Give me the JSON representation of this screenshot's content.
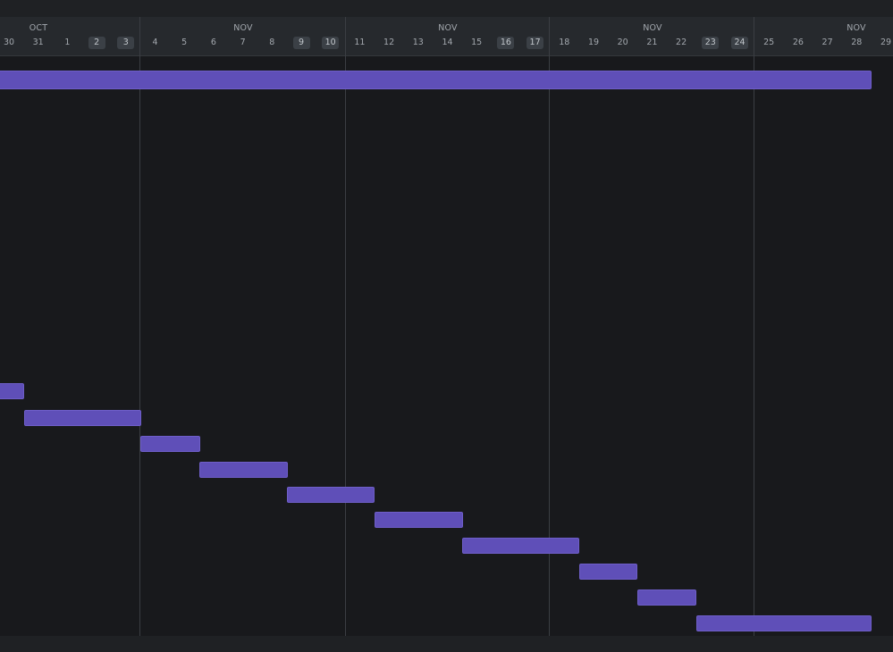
{
  "timeline": {
    "months": [
      "OCT",
      "NOV",
      "NOV",
      "NOV",
      "NOV"
    ],
    "days": [
      {
        "label": "30",
        "weekend": false
      },
      {
        "label": "31",
        "weekend": false
      },
      {
        "label": "1",
        "weekend": false
      },
      {
        "label": "2",
        "weekend": true
      },
      {
        "label": "3",
        "weekend": true
      },
      {
        "label": "4",
        "weekend": false
      },
      {
        "label": "5",
        "weekend": false
      },
      {
        "label": "6",
        "weekend": false
      },
      {
        "label": "7",
        "weekend": false
      },
      {
        "label": "8",
        "weekend": false
      },
      {
        "label": "9",
        "weekend": true
      },
      {
        "label": "10",
        "weekend": true
      },
      {
        "label": "11",
        "weekend": false
      },
      {
        "label": "12",
        "weekend": false
      },
      {
        "label": "13",
        "weekend": false
      },
      {
        "label": "14",
        "weekend": false
      },
      {
        "label": "15",
        "weekend": false
      },
      {
        "label": "16",
        "weekend": true
      },
      {
        "label": "17",
        "weekend": true
      },
      {
        "label": "18",
        "weekend": false
      },
      {
        "label": "19",
        "weekend": false
      },
      {
        "label": "20",
        "weekend": false
      },
      {
        "label": "21",
        "weekend": false
      },
      {
        "label": "22",
        "weekend": false
      },
      {
        "label": "23",
        "weekend": true
      },
      {
        "label": "24",
        "weekend": true
      },
      {
        "label": "25",
        "weekend": false
      },
      {
        "label": "26",
        "weekend": false
      },
      {
        "label": "27",
        "weekend": false
      },
      {
        "label": "28",
        "weekend": false
      },
      {
        "label": "29",
        "weekend": false
      }
    ]
  },
  "tasks": [
    {
      "start": "29",
      "end": "28"
    },
    {
      "start": "29",
      "end": "30"
    },
    {
      "start": "31",
      "end": "3"
    },
    {
      "start": "4",
      "end": "5"
    },
    {
      "start": "6",
      "end": "8"
    },
    {
      "start": "9",
      "end": "11"
    },
    {
      "start": "12",
      "end": "14"
    },
    {
      "start": "15",
      "end": "18"
    },
    {
      "start": "19",
      "end": "20"
    },
    {
      "start": "21",
      "end": "22"
    },
    {
      "start": "23",
      "end": "28"
    }
  ],
  "colors": {
    "background": "#18191c",
    "header": "#26292d",
    "weekend_badge": "#3b4046",
    "bar": "#5f4fb8",
    "divider": "#3b3e43"
  }
}
